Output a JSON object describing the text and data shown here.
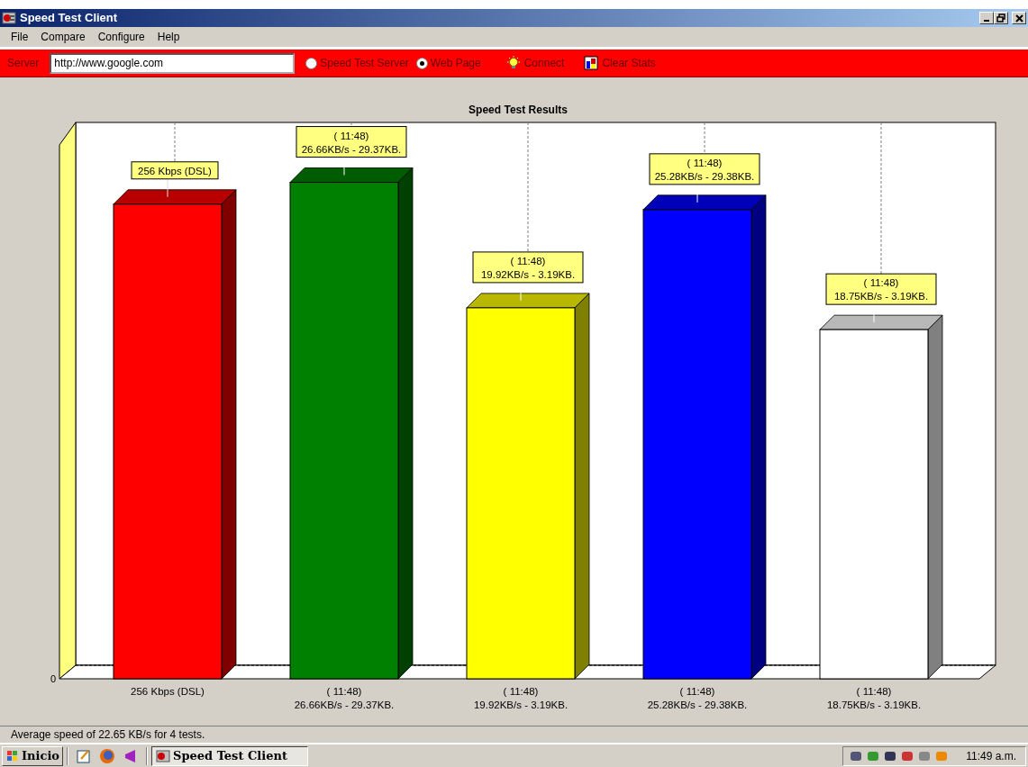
{
  "window": {
    "title": "Speed Test Client"
  },
  "menu": [
    "File",
    "Compare",
    "Configure",
    "Help"
  ],
  "toolbar": {
    "server_label": "Server",
    "url": "http://www.google.com",
    "options": [
      {
        "label": "Speed Test Server",
        "selected": false
      },
      {
        "label": "Web Page",
        "selected": true
      }
    ],
    "buttons": [
      {
        "kind": "connect",
        "label": "Connect"
      },
      {
        "kind": "clear",
        "label": "Clear Stats"
      }
    ]
  },
  "chart": {
    "title": "Speed Test Results",
    "y_tick": "0",
    "bars": [
      {
        "color": "#ff0000",
        "callout": [
          "256 Kbps (DSL)"
        ],
        "label": [
          "256 Kbps (DSL)"
        ]
      },
      {
        "color": "#008000",
        "callout": [
          "( 11:48)",
          "26.66KB/s - 29.37KB."
        ],
        "label": [
          "( 11:48)",
          "26.66KB/s - 29.37KB."
        ]
      },
      {
        "color": "#ffff00",
        "callout": [
          "( 11:48)",
          "19.92KB/s - 3.19KB."
        ],
        "label": [
          "( 11:48)",
          "19.92KB/s - 3.19KB."
        ]
      },
      {
        "color": "#0000ff",
        "callout": [
          "( 11:48)",
          "25.28KB/s - 29.38KB."
        ],
        "label": [
          "( 11:48)",
          "25.28KB/s - 29.38KB."
        ]
      },
      {
        "color": "#ffffff",
        "callout": [
          "( 11:48)",
          "18.75KB/s - 3.19KB."
        ],
        "label": [
          "( 11:48)",
          "18.75KB/s - 3.19KB."
        ]
      }
    ]
  },
  "status_bar": "Average speed of 22.65 KB/s for 4 tests.",
  "taskbar": {
    "start": "Inicio",
    "task": "Speed Test Client",
    "clock": "11:49 a.m."
  }
}
